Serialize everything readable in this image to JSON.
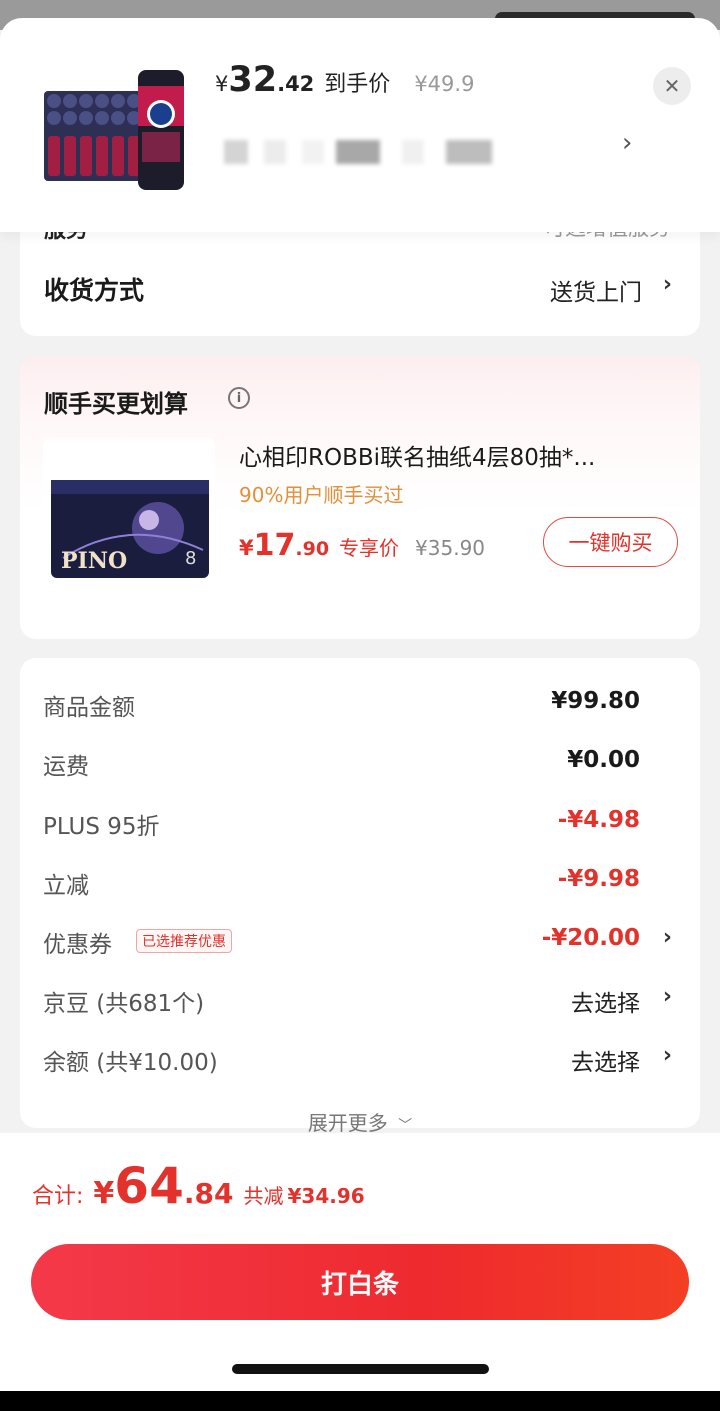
{
  "header": {
    "price_symbol": "¥",
    "price_int": "32",
    "price_dec": ".42",
    "price_tag": "到手价",
    "original_price": "¥49.9",
    "close_icon": "close-icon",
    "chevron_icon": "chevron-right-icon"
  },
  "shipping": {
    "partial_left": "服务",
    "partial_right": "可选增值服务",
    "label": "收货方式",
    "value": "送货上门"
  },
  "addon": {
    "title": "顺手买更划算",
    "product_name": "心相印ROBBi联名抽纸4层80抽*...",
    "social_proof": "90%用户顺手买过",
    "price_symbol": "¥",
    "price_int": "17",
    "price_dec": ".90",
    "price_tag": "专享价",
    "original_price": "¥35.90",
    "buy_label": "一键购买"
  },
  "summary": {
    "rows": [
      {
        "label": "商品金额",
        "value": "¥99.80"
      },
      {
        "label": "运费",
        "value": "¥0.00"
      },
      {
        "label": "PLUS 95折",
        "value": "-¥4.98"
      },
      {
        "label": "立减",
        "value": "-¥9.98"
      },
      {
        "label": "优惠券",
        "badge": "已选推荐优惠",
        "value": "-¥20.00"
      },
      {
        "label": "京豆 (共681个)",
        "value": "去选择"
      },
      {
        "label": "余额 (共¥10.00)",
        "value": "去选择"
      }
    ],
    "expand_label": "展开更多"
  },
  "footer": {
    "total_label": "合计:",
    "total_symbol": "¥",
    "total_int": "64",
    "total_dec": ".84",
    "saved_label": "共减",
    "saved_amount": "¥34.96",
    "pay_label": "打白条"
  },
  "colors": {
    "accent_red": "#e3322b",
    "orange": "#e2903a"
  }
}
